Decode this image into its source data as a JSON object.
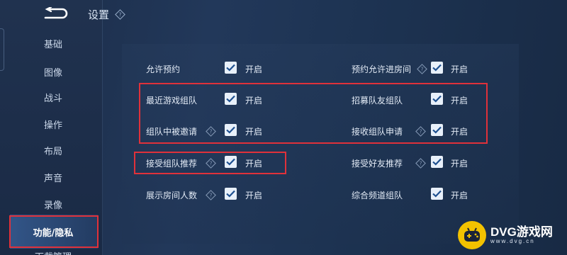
{
  "header": {
    "title": "设置",
    "help_icon": "help-diamond-icon"
  },
  "sidebar": {
    "back_icon": "back-arrow-icon",
    "items": [
      {
        "label": "基础"
      },
      {
        "label": "图像"
      },
      {
        "label": "战斗"
      },
      {
        "label": "操作"
      },
      {
        "label": "布局"
      },
      {
        "label": "声音"
      },
      {
        "label": "录像"
      },
      {
        "label": "功能/隐私",
        "active": true
      },
      {
        "label": "下载管理"
      }
    ]
  },
  "settings": {
    "on_text": "开启",
    "left": [
      {
        "label": "允许预约",
        "checked": true,
        "help": false
      },
      {
        "label": "最近游戏组队",
        "checked": true,
        "help": false
      },
      {
        "label": "组队中被邀请",
        "checked": true,
        "help": true
      },
      {
        "label": "接受组队推荐",
        "checked": true,
        "help": true
      },
      {
        "label": "展示房间人数",
        "checked": true,
        "help": true
      }
    ],
    "right": [
      {
        "label": "预约允许进房间",
        "checked": true,
        "help": true
      },
      {
        "label": "招募队友组队",
        "checked": true,
        "help": false
      },
      {
        "label": "接收组队申请",
        "checked": true,
        "help": true
      },
      {
        "label": "接受好友推荐",
        "checked": true,
        "help": true
      },
      {
        "label": "综合频道组队",
        "checked": true,
        "help": false
      }
    ]
  },
  "colors": {
    "highlight": "#e0313a",
    "checkbox": "#e8f0fa",
    "check": "#1d4f8f"
  },
  "watermark": {
    "main": "DVG游戏网",
    "sub": "www.dvg.cn"
  }
}
